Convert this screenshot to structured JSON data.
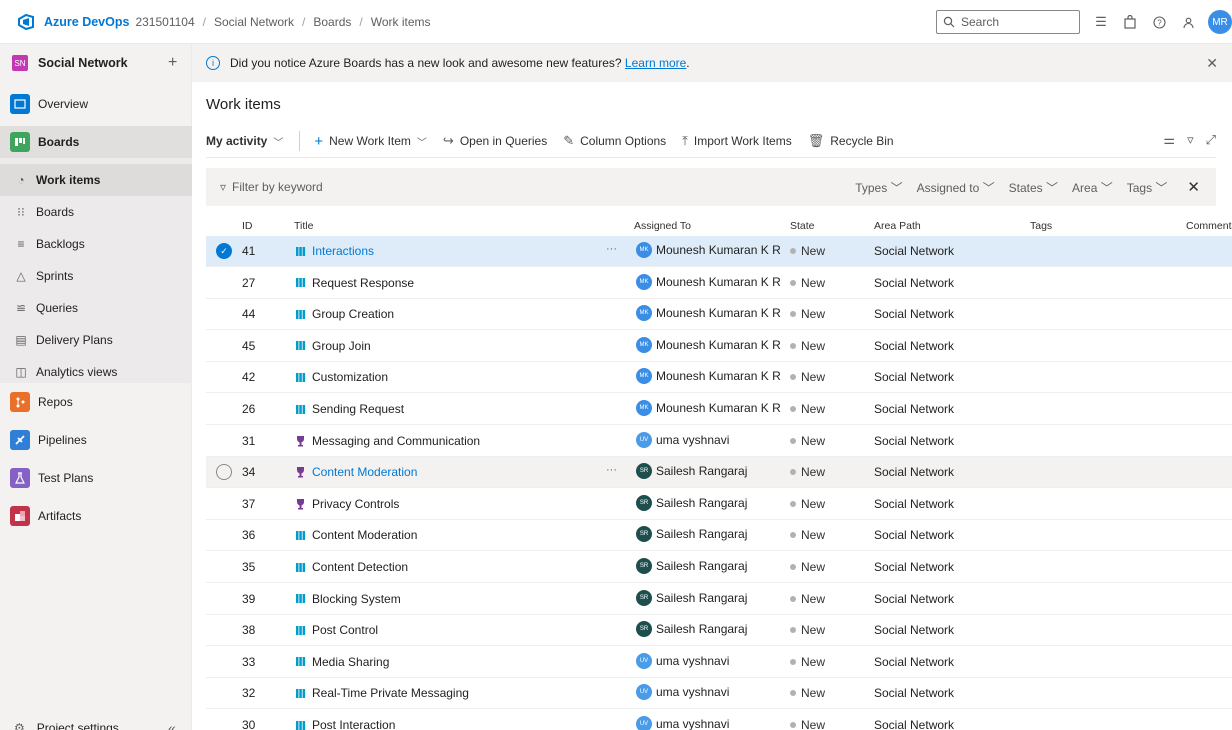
{
  "topbar": {
    "brand": "Azure DevOps",
    "org": "231501104",
    "breadcrumbs": [
      "Social Network",
      "Boards",
      "Work items"
    ],
    "search_placeholder": "Search",
    "avatar_initials": "MR"
  },
  "sidebar": {
    "project_initials": "SN",
    "project_name": "Social Network",
    "add": "+",
    "items": [
      {
        "label": "Overview",
        "icon": "overview-icon"
      },
      {
        "label": "Boards",
        "icon": "boards-icon"
      },
      {
        "label": "Work items",
        "icon": "work-items-icon"
      },
      {
        "label": "Boards",
        "icon": "kanban-icon"
      },
      {
        "label": "Backlogs",
        "icon": "backlogs-icon"
      },
      {
        "label": "Sprints",
        "icon": "sprints-icon"
      },
      {
        "label": "Queries",
        "icon": "queries-icon"
      },
      {
        "label": "Delivery Plans",
        "icon": "delivery-plans-icon"
      },
      {
        "label": "Analytics views",
        "icon": "analytics-icon"
      },
      {
        "label": "Repos",
        "icon": "repos-icon"
      },
      {
        "label": "Pipelines",
        "icon": "pipelines-icon"
      },
      {
        "label": "Test Plans",
        "icon": "test-plans-icon"
      },
      {
        "label": "Artifacts",
        "icon": "artifacts-icon"
      }
    ],
    "settings_label": "Project settings",
    "collapse": "«"
  },
  "banner": {
    "message": "Did you notice Azure Boards has a new look and awesome new features?",
    "link": "Learn more",
    "period": "."
  },
  "page": {
    "title": "Work items"
  },
  "toolbar": {
    "view": "My activity",
    "new_item": "New Work Item",
    "open_queries": "Open in Queries",
    "column_options": "Column Options",
    "import": "Import Work Items",
    "recycle": "Recycle Bin"
  },
  "filter": {
    "placeholder": "Filter by keyword",
    "filters": [
      "Types",
      "Assigned to",
      "States",
      "Area",
      "Tags"
    ]
  },
  "table": {
    "headers": {
      "id": "ID",
      "title": "Title",
      "assigned": "Assigned To",
      "state": "State",
      "area": "Area Path",
      "tags": "Tags",
      "comments": "Comments"
    },
    "rows": [
      {
        "id": "41",
        "title": "Interactions",
        "type": "story",
        "assigned": "Mounesh Kumaran K R",
        "initials": "MK",
        "state": "New",
        "area": "Social Network"
      },
      {
        "id": "27",
        "title": "Request Response",
        "type": "story",
        "assigned": "Mounesh Kumaran K R",
        "initials": "MK",
        "state": "New",
        "area": "Social Network"
      },
      {
        "id": "44",
        "title": "Group Creation",
        "type": "story",
        "assigned": "Mounesh Kumaran K R",
        "initials": "MK",
        "state": "New",
        "area": "Social Network"
      },
      {
        "id": "45",
        "title": "Group Join",
        "type": "story",
        "assigned": "Mounesh Kumaran K R",
        "initials": "MK",
        "state": "New",
        "area": "Social Network"
      },
      {
        "id": "42",
        "title": "Customization",
        "type": "story",
        "assigned": "Mounesh Kumaran K R",
        "initials": "MK",
        "state": "New",
        "area": "Social Network"
      },
      {
        "id": "26",
        "title": "Sending Request",
        "type": "story",
        "assigned": "Mounesh Kumaran K R",
        "initials": "MK",
        "state": "New",
        "area": "Social Network"
      },
      {
        "id": "31",
        "title": "Messaging and Communication",
        "type": "epic",
        "assigned": "uma vyshnavi",
        "initials": "UV",
        "state": "New",
        "area": "Social Network"
      },
      {
        "id": "34",
        "title": "Content Moderation",
        "type": "epic",
        "assigned": "Sailesh Rangaraj",
        "initials": "SR",
        "state": "New",
        "area": "Social Network"
      },
      {
        "id": "37",
        "title": "Privacy Controls",
        "type": "epic",
        "assigned": "Sailesh Rangaraj",
        "initials": "SR",
        "state": "New",
        "area": "Social Network"
      },
      {
        "id": "36",
        "title": "Content Moderation",
        "type": "story",
        "assigned": "Sailesh Rangaraj",
        "initials": "SR",
        "state": "New",
        "area": "Social Network"
      },
      {
        "id": "35",
        "title": "Content Detection",
        "type": "story",
        "assigned": "Sailesh Rangaraj",
        "initials": "SR",
        "state": "New",
        "area": "Social Network"
      },
      {
        "id": "39",
        "title": "Blocking System",
        "type": "story",
        "assigned": "Sailesh Rangaraj",
        "initials": "SR",
        "state": "New",
        "area": "Social Network"
      },
      {
        "id": "38",
        "title": "Post Control",
        "type": "story",
        "assigned": "Sailesh Rangaraj",
        "initials": "SR",
        "state": "New",
        "area": "Social Network"
      },
      {
        "id": "33",
        "title": "Media Sharing",
        "type": "story",
        "assigned": "uma vyshnavi",
        "initials": "UV",
        "state": "New",
        "area": "Social Network"
      },
      {
        "id": "32",
        "title": "Real-Time Private Messaging",
        "type": "story",
        "assigned": "uma vyshnavi",
        "initials": "UV",
        "state": "New",
        "area": "Social Network"
      },
      {
        "id": "30",
        "title": "Post Interaction",
        "type": "story",
        "assigned": "uma vyshnavi",
        "initials": "UV",
        "state": "New",
        "area": "Social Network"
      }
    ]
  },
  "colors": {
    "accent": "#0078d4",
    "story_icon": "#009ccc",
    "epic_icon": "#773b93",
    "avatar_mk": "#3a8ee6",
    "avatar_uv": "#4a9be8",
    "avatar_sr": "#1f4e4e"
  }
}
